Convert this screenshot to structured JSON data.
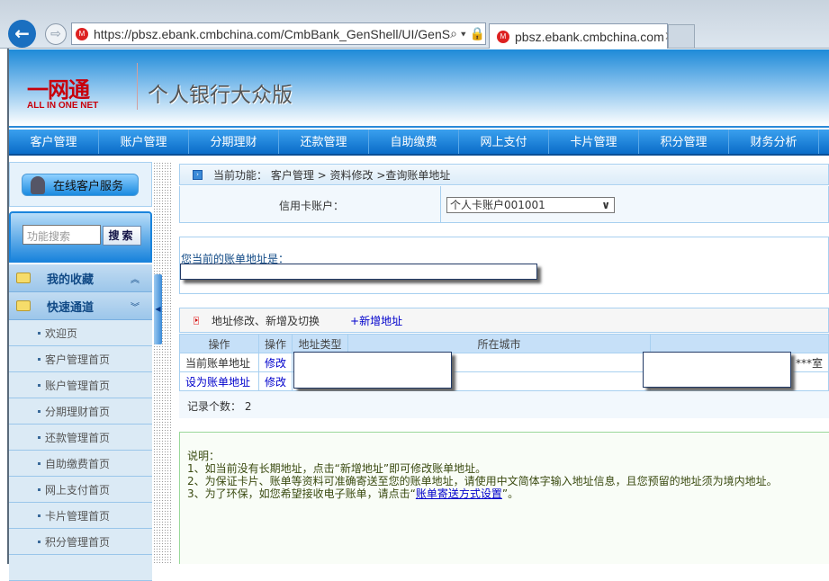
{
  "browser": {
    "url": "https://pbsz.ebank.cmbchina.com/CmbBank_GenShell/UI/GenS",
    "tab_title": "pbsz.ebank.cmbchina.com",
    "url_tools": "⌕ ▾ 🔒 ↻"
  },
  "banner": {
    "logo_cn": "一网通",
    "logo_en": "ALL IN ONE NET",
    "title": "个人银行大众版"
  },
  "nav": [
    "客户管理",
    "账户管理",
    "分期理财",
    "还款管理",
    "自助缴费",
    "网上支付",
    "卡片管理",
    "积分管理",
    "财务分析"
  ],
  "sidebar": {
    "service_button": "在线客户服务",
    "search_placeholder": "功能搜索",
    "search_button": "搜索",
    "groups": [
      {
        "label": "我的收藏",
        "chevron": "︽"
      },
      {
        "label": "快速通道",
        "chevron": "︾"
      }
    ],
    "links": [
      "欢迎页",
      "客户管理首页",
      "账户管理首页",
      "分期理财首页",
      "还款管理首页",
      "自助缴费首页",
      "网上支付首页",
      "卡片管理首页",
      "积分管理首页"
    ]
  },
  "breadcrumb": "当前功能： 客户管理 > 资料修改 >查询账单地址",
  "account": {
    "label": "信用卡账户：",
    "selected": "个人卡账户001001"
  },
  "current_address": {
    "label": "您当前的账单地址是："
  },
  "section": {
    "title": "地址修改、新增及切换",
    "add_link": "+新增地址"
  },
  "table": {
    "headers": [
      "操作",
      "操作",
      "地址类型",
      "所在城市",
      ""
    ],
    "rows": [
      {
        "action": "当前账单地址",
        "edit": "修改",
        "tail": "***室"
      },
      {
        "action": "设为账单地址",
        "edit": "修改",
        "tail": ""
      }
    ]
  },
  "record_count": "记录个数： 2",
  "notes": {
    "title": "说明：",
    "items": [
      "1、如当前没有长期地址，点击“新增地址”即可修改账单地址。",
      "2、为保证卡片、账单等资料可准确寄送至您的账单地址，请使用中文简体字输入地址信息，且您预留的地址须为境内地址。"
    ],
    "item3_prefix": "3、为了环保，如您希望接收电子账单，请点击“",
    "item3_link": "账单寄送方式设置",
    "item3_suffix": "”。"
  }
}
